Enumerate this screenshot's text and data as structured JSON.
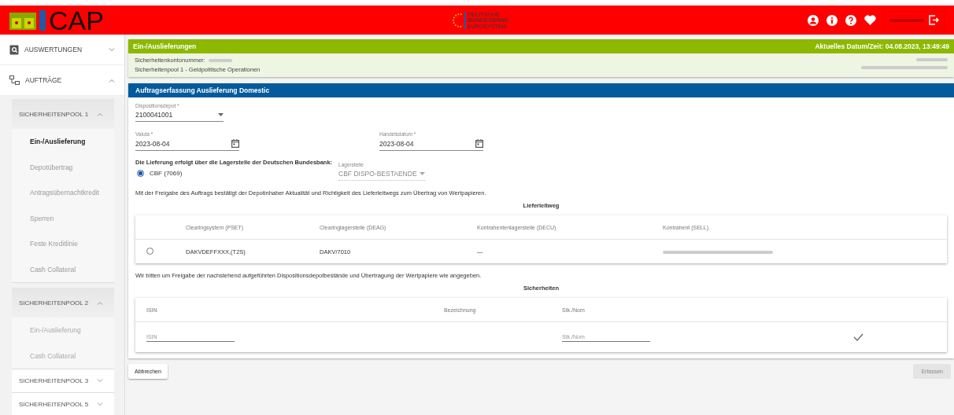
{
  "header": {
    "app_name": "CAP",
    "bank_logo": [
      "DEUTSCHE",
      "BUNDESBANK",
      "EUROSYSTEM"
    ]
  },
  "sidebar": {
    "items": [
      {
        "label": "AUSWERTUNGEN",
        "expanded": false
      },
      {
        "label": "AUFTRÄGE",
        "expanded": true,
        "children": [
          {
            "label": "SICHERHEITENPOOL 1",
            "expanded": true,
            "children": [
              {
                "label": "Ein-/Auslieferung",
                "selected": true
              },
              {
                "label": "Depotübertrag",
                "selected": false
              },
              {
                "label": "Antragsübernachtkredit",
                "selected": false
              },
              {
                "label": "Sperren",
                "selected": false
              },
              {
                "label": "Feste Kreditlinie",
                "selected": false
              },
              {
                "label": "Cash Collateral",
                "selected": false
              }
            ]
          },
          {
            "label": "SICHERHEITENPOOL 2",
            "expanded": true,
            "children": [
              {
                "label": "Ein-/Auslieferung",
                "selected": false
              },
              {
                "label": "Cash Collateral",
                "selected": false
              }
            ]
          },
          {
            "label": "SICHERHEITENPOOL 3",
            "expanded": false
          },
          {
            "label": "SICHERHEITENPOOL 5",
            "expanded": false
          }
        ]
      }
    ]
  },
  "info_panel": {
    "title": "Ein-/Auslieferungen",
    "datetime": "Aktuelles Datum/Zeit: 04.08.2023, 13:49:49",
    "account_label": "Sicherheitenkontonummer:",
    "pool": "Sicherheitenpool 1 - Geldpolitische Operationen"
  },
  "form": {
    "title": "Auftragserfassung Auslieferung Domestic",
    "depot": {
      "label": "Dispositionsdepot *",
      "value": "2100041001"
    },
    "valuta": {
      "label": "Valuta *",
      "value": "2023-08-04"
    },
    "handelsdatum": {
      "label": "Handelsdatum *",
      "value": "2023-08-04"
    },
    "delivery_text": "Die Lieferung erfolgt über die Lagerstelle der Deutschen Bundesbank:",
    "radio": {
      "label": "CBF (7069)",
      "selected": true
    },
    "lagerstelle": {
      "label": "Lagerstelle",
      "value": "CBF DISPO-BESTAENDE",
      "disabled": true
    },
    "confirm_text": "Mit der Freigabe des Auftrags bestätigt der Depotinhaber Aktualität und Richtigkeit des Lieferleitwegs zum Übertrag von Wertpapieren.",
    "route_table": {
      "title": "Lieferleitweg",
      "columns": [
        "Clearingsystem (PSET)",
        "Clearinglagerstelle (DEAG)",
        "Kontrahentenlagerstelle (DECU)",
        "Kontrahent (SELL)"
      ],
      "rows": [
        {
          "selected": false,
          "cells": [
            "DAKVDEFFXXX,(T2S)",
            "DAKV/7010",
            "—"
          ]
        }
      ]
    },
    "request_text": "Wir bitten um Freigabe der nachstehend aufgeführten Dispositionsdepotbestände und Übertragung der Wertpapiere wie angegeben.",
    "securities_table": {
      "title": "Sicherheiten",
      "columns": [
        "ISIN",
        "Bezeichnung",
        "Stk./Nom"
      ],
      "isin_placeholder": "ISIN",
      "nominal_placeholder": "Stk./Nom"
    }
  },
  "buttons": [
    {
      "label": "Abbrechen",
      "disabled": false
    },
    {
      "label": "Erfassen",
      "disabled": true
    }
  ]
}
